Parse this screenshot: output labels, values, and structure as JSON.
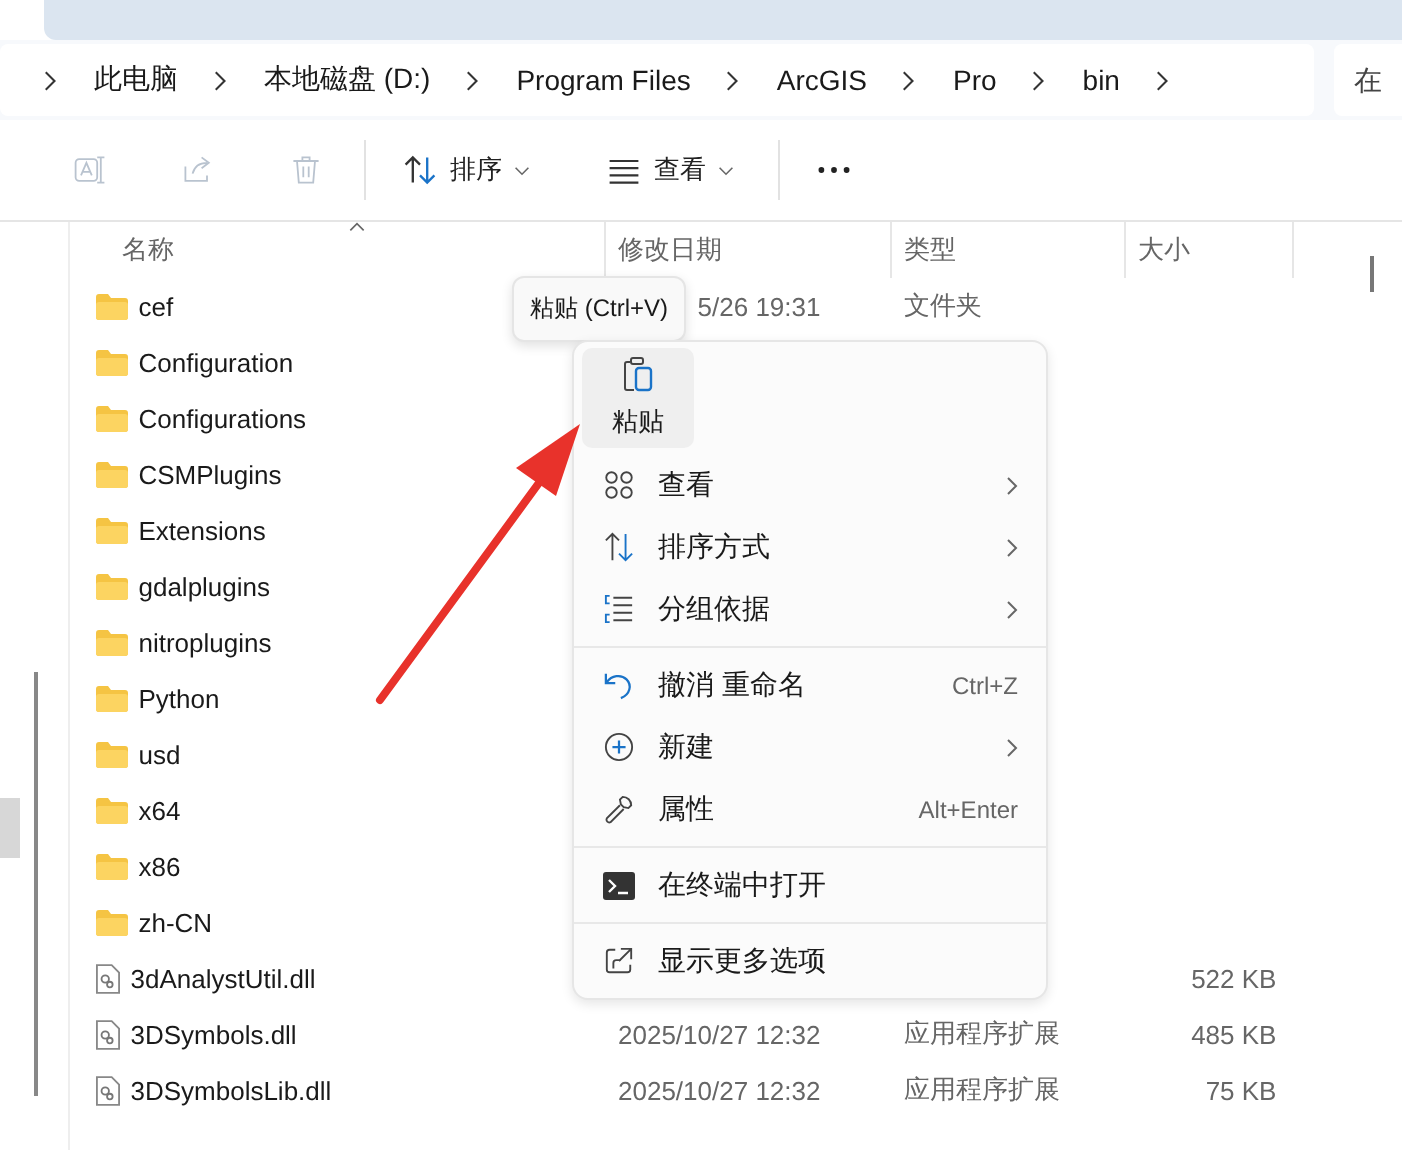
{
  "breadcrumb": [
    "此电脑",
    "本地磁盘 (D:)",
    "Program Files",
    "ArcGIS",
    "Pro",
    "bin"
  ],
  "search": {
    "placeholder": "在"
  },
  "toolbar": [
    {
      "kind": "rename",
      "disabled": true
    },
    {
      "kind": "share",
      "disabled": true
    },
    {
      "kind": "delete",
      "disabled": true
    },
    {
      "kind": "divider"
    },
    {
      "kind": "sort",
      "label": "排序"
    },
    {
      "kind": "view",
      "label": "查看"
    },
    {
      "kind": "divider"
    },
    {
      "kind": "more"
    }
  ],
  "columns": [
    "名称",
    "修改日期",
    "类型",
    "大小"
  ],
  "files": [
    {
      "kind": "folder",
      "name": "cef",
      "date": "5/26 19:31",
      "type": "文件夹"
    },
    {
      "kind": "folder",
      "name": "Configuration"
    },
    {
      "kind": "folder",
      "name": "Configurations"
    },
    {
      "kind": "folder",
      "name": "CSMPlugins"
    },
    {
      "kind": "folder",
      "name": "Extensions"
    },
    {
      "kind": "folder",
      "name": "gdalplugins"
    },
    {
      "kind": "folder",
      "name": "nitroplugins"
    },
    {
      "kind": "folder",
      "name": "Python"
    },
    {
      "kind": "folder",
      "name": "usd"
    },
    {
      "kind": "folder",
      "name": "x64"
    },
    {
      "kind": "folder",
      "name": "x86"
    },
    {
      "kind": "folder",
      "name": "zh-CN"
    },
    {
      "kind": "file",
      "name": "3dAnalystUtil.dll",
      "size": "522 KB"
    },
    {
      "kind": "file",
      "name": "3DSymbols.dll",
      "date": "2025/10/27 12:32",
      "type": "应用程序扩展",
      "size": "485 KB"
    },
    {
      "kind": "file",
      "name": "3DSymbolsLib.dll",
      "date": "2025/10/27 12:32",
      "type": "应用程序扩展",
      "size": "75 KB"
    }
  ],
  "tooltip": "粘贴 (Ctrl+V)",
  "context_menu": {
    "top_actions": [
      {
        "kind": "paste",
        "label": "粘贴",
        "highlighted": true
      }
    ],
    "items": [
      {
        "kind": "view",
        "label": "查看",
        "submenu": true
      },
      {
        "kind": "sort",
        "label": "排序方式",
        "submenu": true
      },
      {
        "kind": "group",
        "label": "分组依据",
        "submenu": true
      },
      {
        "kind": "divider"
      },
      {
        "kind": "undo",
        "label": "撤消 重命名",
        "shortcut": "Ctrl+Z",
        "submenu": false
      },
      {
        "kind": "new",
        "label": "新建",
        "submenu": true
      },
      {
        "kind": "properties",
        "label": "属性",
        "shortcut": "Alt+Enter",
        "submenu": false
      },
      {
        "kind": "divider"
      },
      {
        "kind": "terminal",
        "label": "在终端中打开",
        "submenu": false
      },
      {
        "kind": "divider"
      },
      {
        "kind": "more",
        "label": "显示更多选项",
        "submenu": false
      }
    ]
  }
}
